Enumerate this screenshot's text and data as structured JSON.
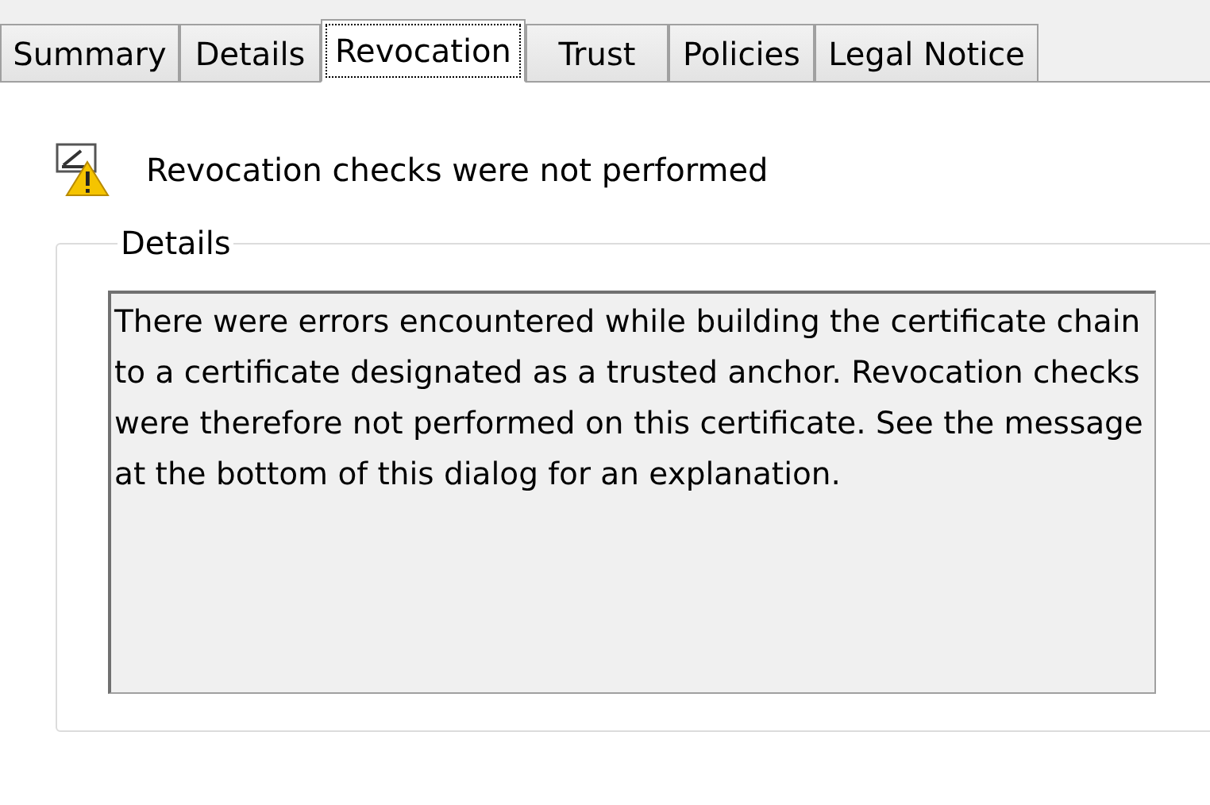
{
  "tabs": [
    {
      "label": "Summary",
      "selected": false
    },
    {
      "label": "Details",
      "selected": false
    },
    {
      "label": "Revocation",
      "selected": true
    },
    {
      "label": "Trust",
      "selected": false
    },
    {
      "label": "Policies",
      "selected": false
    },
    {
      "label": "Legal Notice",
      "selected": false
    }
  ],
  "status": {
    "message": "Revocation checks were not performed"
  },
  "details": {
    "legend": "Details",
    "text": "There were errors encountered while building the certificate chain to a certificate designated as a trusted anchor. Revocation checks were therefore not performed on this certificate. See the message at the bottom of this dialog for an explanation."
  }
}
